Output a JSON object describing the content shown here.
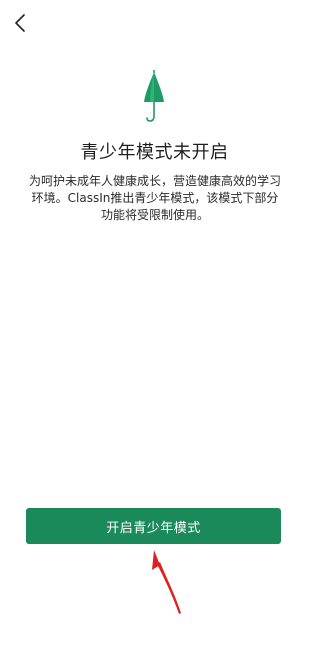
{
  "header": {
    "back_icon": "chevron-left-icon"
  },
  "main": {
    "illustration_icon": "umbrella-icon",
    "title": "青少年模式未开启",
    "description": "为呵护未成年人健康成长，营造健康高效的学习环境。ClassIn推出青少年模式，该模式下部分功能将受限制使用。",
    "enable_button_label": "开启青少年模式"
  },
  "colors": {
    "accent": "#1b8a5a",
    "umbrella": "#1f9a64",
    "annotation_arrow": "#e02020"
  }
}
